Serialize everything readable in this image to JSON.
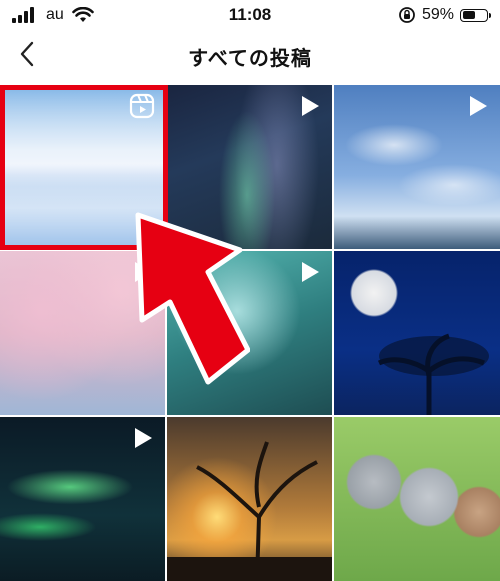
{
  "status_bar": {
    "carrier": "au",
    "time": "11:08",
    "battery_percent": "59%",
    "battery_level": 0.59
  },
  "header": {
    "back_icon": "chevron-left-icon",
    "title": "すべての投稿"
  },
  "grid": {
    "tiles": [
      {
        "subject": "sky-reflection",
        "badge": "reel-icon"
      },
      {
        "subject": "aurora-milky-way",
        "badge": "play-icon"
      },
      {
        "subject": "clouds-sky",
        "badge": "play-icon"
      },
      {
        "subject": "cherry-blossom-tree",
        "badge": "play-icon"
      },
      {
        "subject": "dandelion-dewdrops",
        "badge": "play-icon"
      },
      {
        "subject": "full-moon-tree",
        "badge": "none"
      },
      {
        "subject": "green-aurora",
        "badge": "play-icon"
      },
      {
        "subject": "sunset-tree",
        "badge": "none"
      },
      {
        "subject": "kittens",
        "badge": "none"
      }
    ]
  },
  "annotation": {
    "highlight_color": "#e60012",
    "arrow_color": "#e60012"
  }
}
